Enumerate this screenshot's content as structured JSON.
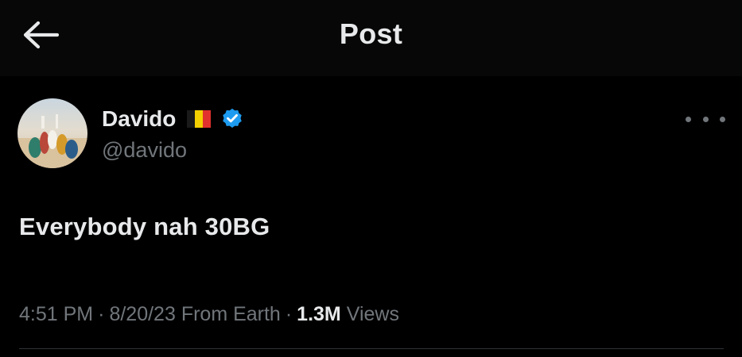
{
  "header": {
    "title": "Post",
    "back_icon": "arrow-left-icon"
  },
  "post": {
    "author": {
      "display_name": "Davido",
      "handle": "@davido",
      "flag_icon": "belgium-flag-icon",
      "flag_colors": [
        "#1a1a1a",
        "#f5d000",
        "#e2322d"
      ],
      "verified_icon": "verified-badge-icon",
      "verified_color": "#1d9bf0"
    },
    "text": "Everybody nah 30BG",
    "time": "4:51 PM",
    "date": "8/20/23",
    "source": "From Earth",
    "separator": "·",
    "views_count": "1.3M",
    "views_label": "Views",
    "more_icon": "more-options-icon"
  },
  "colors": {
    "background": "#000000",
    "header_background": "#070707",
    "primary_text": "#e7e9ea",
    "secondary_text": "#71767b",
    "divider": "#2f3336",
    "accent": "#1d9bf0"
  }
}
